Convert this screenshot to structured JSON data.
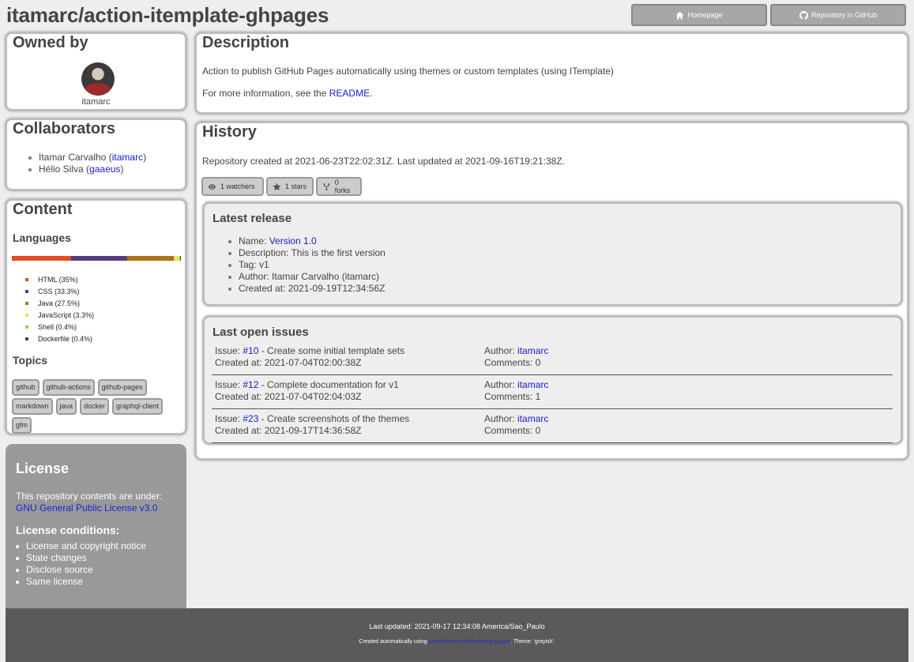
{
  "header": {
    "title": "itamarc/action-itemplate-ghpages",
    "home_button": "Homepage",
    "repo_button": "Repository in GitHub"
  },
  "owner": {
    "heading": "Owned by",
    "login": "itamarc"
  },
  "collaborators": {
    "heading": "Collaborators",
    "items": [
      {
        "name": "Itamar Carvalho",
        "login": "itamarc"
      },
      {
        "name": "Hélio Silva",
        "login": "gaaeus"
      }
    ]
  },
  "content": {
    "heading": "Content",
    "languages_heading": "Languages",
    "languages": [
      {
        "label": "HTML (35%)",
        "percent": 35,
        "color": "#e34c26"
      },
      {
        "label": "CSS (33.3%)",
        "percent": 33.3,
        "color": "#563d7c"
      },
      {
        "label": "Java (27.5%)",
        "percent": 27.5,
        "color": "#b07219"
      },
      {
        "label": "JavaScript (3.3%)",
        "percent": 3.3,
        "color": "#f1e05a"
      },
      {
        "label": "Shell (0.4%)",
        "percent": 0.4,
        "color": "#89e051"
      },
      {
        "label": "Dockerfile (0.4%)",
        "percent": 0.4,
        "color": "#384d54"
      }
    ],
    "topics_heading": "Topics",
    "topics": [
      "github",
      "github-actions",
      "github-pages",
      "markdown",
      "java",
      "docker",
      "graphql-client",
      "gfm"
    ]
  },
  "license": {
    "heading": "License",
    "intro": "This repository contents are under:",
    "name": "GNU General Public License v3.0",
    "conditions_heading": "License conditions:",
    "conditions": [
      "License and copyright notice",
      "State changes",
      "Disclose source",
      "Same license"
    ]
  },
  "description": {
    "heading": "Description",
    "text": "Action to publish GitHub Pages automatically using themes or custom templates (using ITemplate)",
    "more_prefix": "For more information, see the ",
    "more_link": "README",
    "more_suffix": "."
  },
  "history": {
    "heading": "History",
    "created_text": "Repository created at 2021-06-23T22:02:31Z. Last updated at 2021-09-16T19:21:38Z.",
    "watchers": "1 watchers",
    "stars": "1 stars",
    "forks": "0 forks"
  },
  "release": {
    "heading": "Latest release",
    "name_label": "Name: ",
    "name": "Version 1.0",
    "description": "Description: This is the first version",
    "tag": "Tag: v1",
    "author": "Author: Itamar Carvalho (itamarc)",
    "created": "Created at: 2021-09-19T12:34:56Z"
  },
  "issues": {
    "heading": "Last open issues",
    "issue_label": "Issue: ",
    "author_label": "Author: ",
    "items": [
      {
        "number": "#10",
        "title": " - Create some initial template sets",
        "created": "Created at: 2021-07-04T02:00:38Z",
        "author": "itamarc",
        "comments": "Comments: 0"
      },
      {
        "number": "#12",
        "title": " - Complete documentation for v1",
        "created": "Created at: 2021-07-04T02:04:03Z",
        "author": "itamarc",
        "comments": "Comments: 1"
      },
      {
        "number": "#23",
        "title": " - Create screenshots of the themes",
        "created": "Created at: 2021-09-17T14:36:58Z",
        "author": "itamarc",
        "comments": "Comments: 0"
      }
    ]
  },
  "footer": {
    "updated": "Last updated: 2021-09-17 12:34:08 America/Sao_Paulo",
    "created_prefix": "Created automatically using ",
    "created_link": "itamarc/action-itemplate-ghpages",
    "created_suffix": ". Theme: 'grayish'."
  }
}
